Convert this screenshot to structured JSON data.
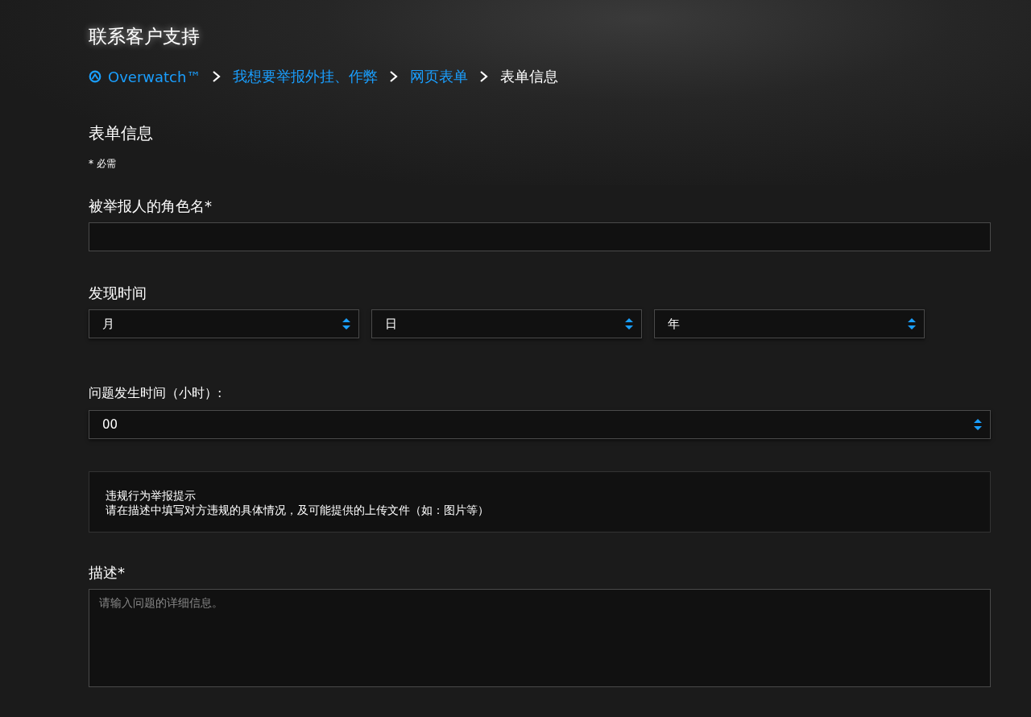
{
  "page_title": "联系客户支持",
  "breadcrumb": [
    {
      "label": "Overwatch™",
      "kind": "game",
      "current": false
    },
    {
      "label": "我想要举报外挂、作弊",
      "kind": "link",
      "current": false
    },
    {
      "label": "网页表单",
      "kind": "link",
      "current": false
    },
    {
      "label": "表单信息",
      "kind": "link",
      "current": true
    }
  ],
  "form": {
    "title": "表单信息",
    "required_note": "*  必需",
    "fields": [
      {
        "kind": "text",
        "label": "被举报人的角色名*"
      },
      {
        "kind": "date",
        "label": "发现时间",
        "selects": [
          {
            "value": "月"
          },
          {
            "value": "日"
          },
          {
            "value": "年"
          }
        ]
      },
      {
        "kind": "select",
        "label": "问题发生时间（小时）:",
        "value": "00"
      },
      {
        "kind": "notice",
        "lines": [
          "违规行为举报提示",
          "请在描述中填写对方违规的具体情况，及可能提供的上传文件（如：图片等）"
        ]
      },
      {
        "kind": "textarea",
        "label": "描述*",
        "placeholder": "请输入问题的详细信息。"
      }
    ]
  }
}
